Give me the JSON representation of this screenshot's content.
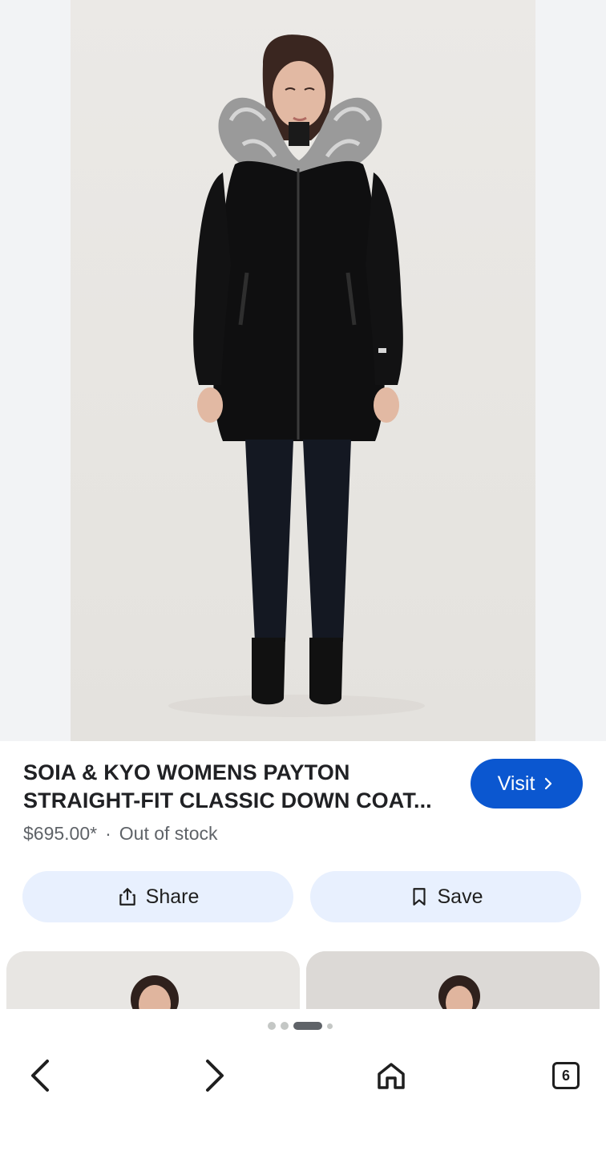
{
  "product": {
    "title": "SOIA & KYO WOMENS PAYTON STRAIGHT-FIT CLASSIC DOWN COAT...",
    "price": "$695.00*",
    "separator": "·",
    "stock_status": "Out of stock",
    "visit_label": "Visit"
  },
  "actions": {
    "share_label": "Share",
    "save_label": "Save"
  },
  "navigation": {
    "tab_count": "6",
    "page_indicator": {
      "count": 4,
      "active_index": 2
    }
  },
  "colors": {
    "visit_button": "#0b57d0",
    "action_button_bg": "#e8f0fe",
    "coat": "#0f0f10",
    "fur": "#9a9a9a"
  },
  "icons": {
    "visit": "chevron-right-icon",
    "share": "share-icon",
    "save": "bookmark-icon",
    "back": "back-arrow-icon",
    "forward": "forward-arrow-icon",
    "home": "home-icon",
    "tabs": "tabs-icon"
  }
}
